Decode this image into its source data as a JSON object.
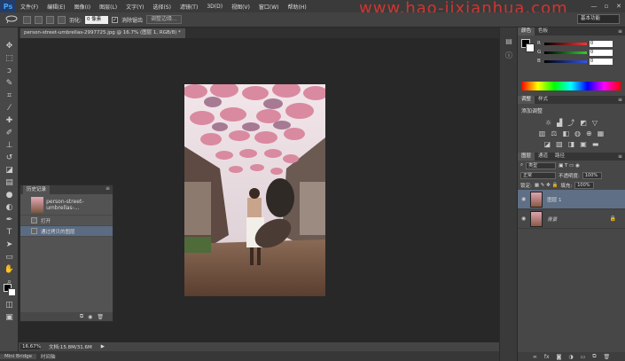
{
  "app": {
    "logo": "Ps",
    "menus": [
      "文件(F)",
      "编辑(E)",
      "图像(I)",
      "图层(L)",
      "文字(Y)",
      "选择(S)",
      "滤镜(T)",
      "3D(D)",
      "视图(V)",
      "窗口(W)",
      "帮助(H)"
    ],
    "window_controls": [
      "—",
      "▫",
      "✕"
    ]
  },
  "watermark": "www.hao-jixianhua.com",
  "options": {
    "feather_label": "羽化:",
    "feather_value": "0 像素",
    "antialias_label": "消除锯齿",
    "antialias_checked": "✓",
    "refine_button": "调整边缘...",
    "workspace": "基本功能"
  },
  "document": {
    "tab_title": "person-street-umbrellas-2997725.jpg @ 16.7% (图层 1, RGB/8) *"
  },
  "status": {
    "zoom": "16.67%",
    "doc_info": "文档:15.8M/31.6M",
    "arrow": "▶"
  },
  "bridge": {
    "tabs": [
      "Mini Bridge",
      "时间轴"
    ]
  },
  "history": {
    "title": "历史记录",
    "snapshot_name": "person-street-umbrellas-...",
    "items": [
      {
        "label": "打开"
      },
      {
        "label": "通过拷贝的图层"
      }
    ]
  },
  "color_panel": {
    "tabs": [
      "颜色",
      "色板"
    ],
    "channels": [
      {
        "label": "R",
        "value": "0",
        "color": "#e33"
      },
      {
        "label": "G",
        "value": "0",
        "color": "#3c3"
      },
      {
        "label": "B",
        "value": "0",
        "color": "#35e"
      }
    ]
  },
  "adjust_panel": {
    "tabs": [
      "调整",
      "样式"
    ],
    "title": "添加调整"
  },
  "layers_panel": {
    "tabs": [
      "图层",
      "通道",
      "路径"
    ],
    "kind_label": "类型",
    "blend_mode": "正常",
    "opacity_label": "不透明度:",
    "opacity_value": "100%",
    "lock_label": "锁定:",
    "fill_label": "填充:",
    "fill_value": "100%",
    "layers": [
      {
        "name": "图层 1"
      },
      {
        "name": "背景"
      }
    ]
  },
  "colors": {
    "accent": "#5f6f86",
    "watermark": "#e2342f"
  }
}
